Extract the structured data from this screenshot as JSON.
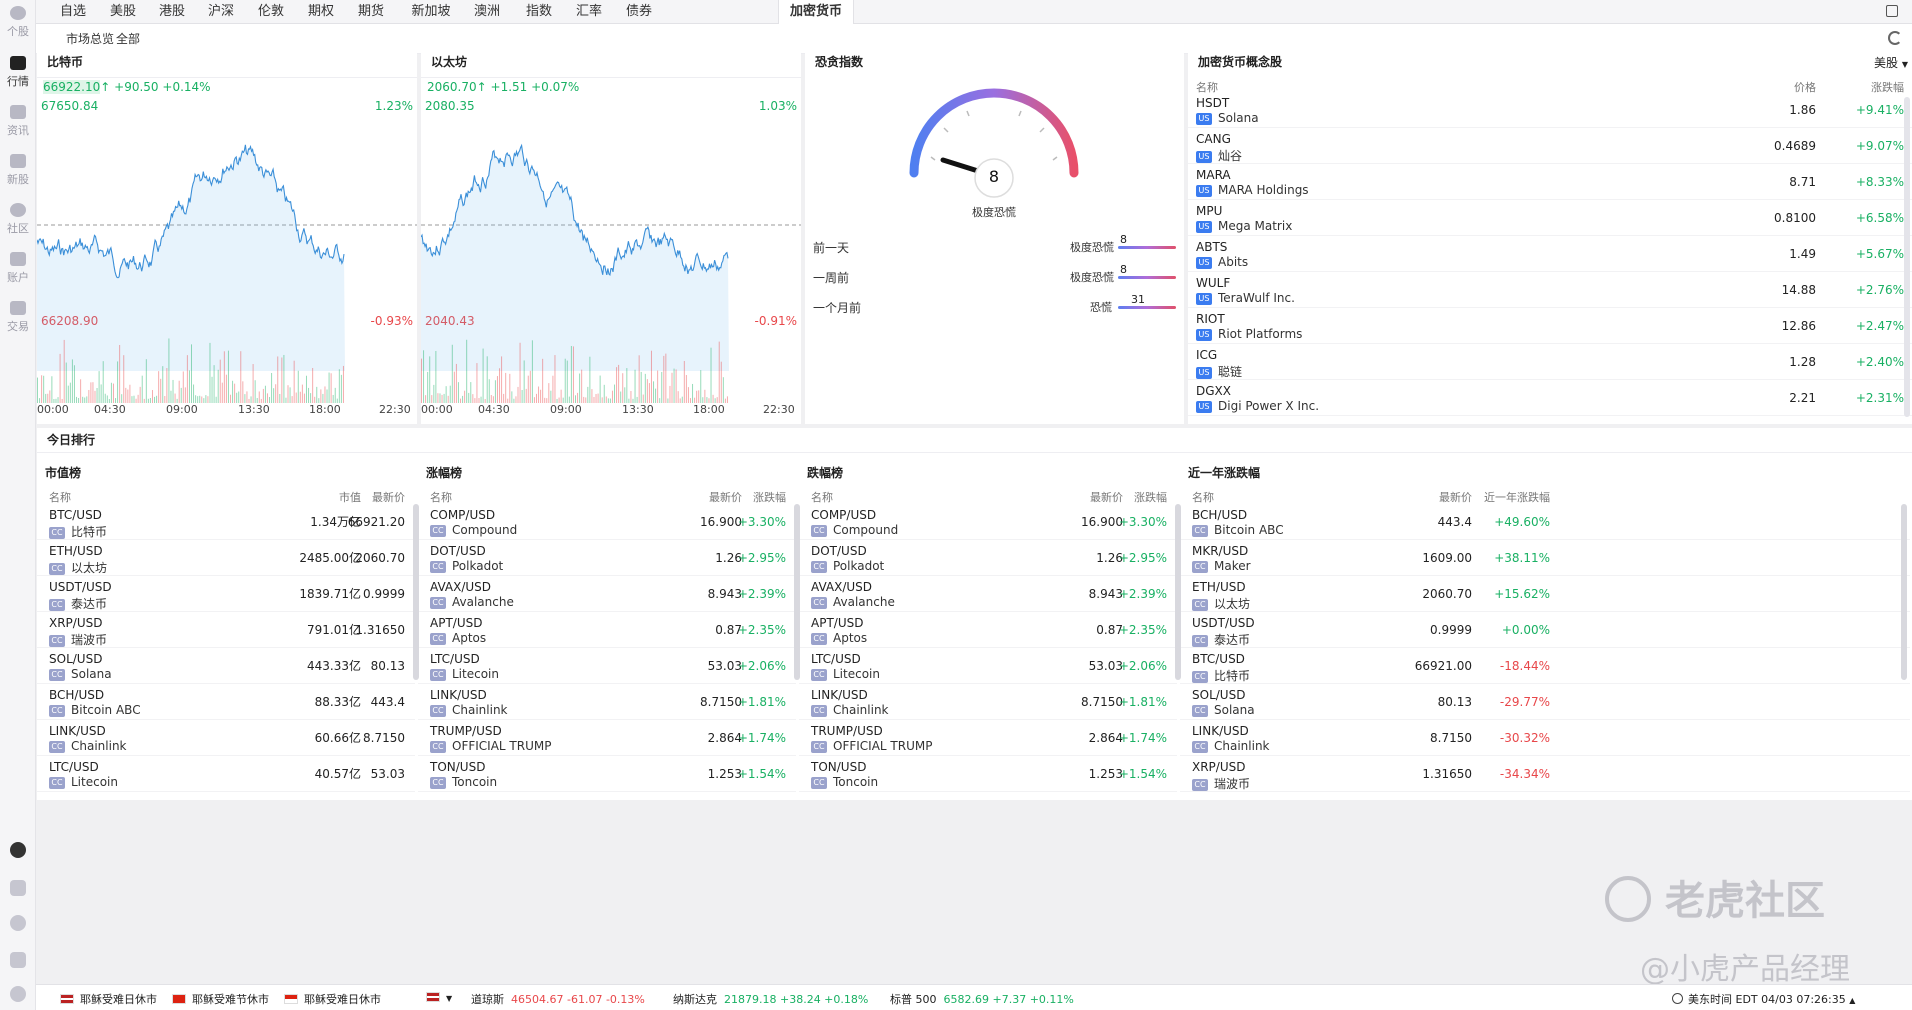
{
  "sidebar": {
    "items": [
      {
        "label": "个股"
      },
      {
        "label": "行情"
      },
      {
        "label": "资讯"
      },
      {
        "label": "新股"
      },
      {
        "label": "社区"
      },
      {
        "label": "账户"
      },
      {
        "label": "交易"
      }
    ]
  },
  "tabs": [
    "自选",
    "美股",
    "港股",
    "沪深",
    "伦敦",
    "期权",
    "期货",
    "新加坡",
    "澳洲",
    "指数",
    "汇率",
    "债券",
    "加密货币"
  ],
  "subtabs": [
    "市场总览",
    "全部"
  ],
  "btc": {
    "title": "比特币",
    "price": "66922.10",
    "arrow": "↑",
    "change": "+90.50",
    "pct": "+0.14%",
    "high": "67650.84",
    "high_pct": "1.23%",
    "low": "66208.90",
    "low_pct": "-0.93%",
    "times": [
      "00:00",
      "04:30",
      "09:00",
      "13:30",
      "18:00",
      "22:30"
    ]
  },
  "eth": {
    "title": "以太坊",
    "price": "2060.70",
    "arrow": "↑",
    "change": "+1.51",
    "pct": "+0.07%",
    "high": "2080.35",
    "high_pct": "1.03%",
    "low": "2040.43",
    "low_pct": "-0.91%",
    "times": [
      "00:00",
      "04:30",
      "09:00",
      "13:30",
      "18:00",
      "22:30"
    ]
  },
  "fear": {
    "title": "恐贪指数",
    "value": "8",
    "label": "极度恐慌",
    "history": [
      {
        "period": "前一天",
        "status": "极度恐慌",
        "value": "8",
        "level": 8
      },
      {
        "period": "一周前",
        "status": "极度恐慌",
        "value": "8",
        "level": 8
      },
      {
        "period": "一个月前",
        "status": "恐慌",
        "value": "31",
        "level": 31
      }
    ]
  },
  "concept": {
    "title": "加密货币概念股",
    "market": "美股",
    "headers": [
      "名称",
      "价格",
      "涨跌幅"
    ],
    "rows": [
      {
        "sym": "HSDT",
        "badge": "US",
        "name": "Solana",
        "price": "1.86",
        "chg": "+9.41%"
      },
      {
        "sym": "CANG",
        "badge": "US",
        "name": "灿谷",
        "price": "0.4689",
        "chg": "+9.07%"
      },
      {
        "sym": "MARA",
        "badge": "US",
        "name": "MARA Holdings",
        "price": "8.71",
        "chg": "+8.33%"
      },
      {
        "sym": "MPU",
        "badge": "US",
        "name": "Mega Matrix",
        "price": "0.8100",
        "chg": "+6.58%"
      },
      {
        "sym": "ABTS",
        "badge": "US",
        "name": "Abits",
        "price": "1.49",
        "chg": "+5.67%"
      },
      {
        "sym": "WULF",
        "badge": "US",
        "name": "TeraWulf Inc.",
        "price": "14.88",
        "chg": "+2.76%"
      },
      {
        "sym": "RIOT",
        "badge": "US",
        "name": "Riot Platforms",
        "price": "12.86",
        "chg": "+2.47%"
      },
      {
        "sym": "ICG",
        "badge": "US",
        "name": "聪链",
        "price": "1.28",
        "chg": "+2.40%"
      },
      {
        "sym": "DGXX",
        "badge": "US",
        "name": "Digi Power X Inc.",
        "price": "2.21",
        "chg": "+2.31%"
      }
    ]
  },
  "ranking": {
    "title": "今日排行",
    "market_cap": {
      "title": "市值榜",
      "headers": [
        "名称",
        "市值",
        "最新价"
      ],
      "rows": [
        {
          "sym": "BTC/USD",
          "name": "比特币",
          "a": "1.34万亿",
          "b": "66921.20"
        },
        {
          "sym": "ETH/USD",
          "name": "以太坊",
          "a": "2485.00亿",
          "b": "2060.70"
        },
        {
          "sym": "USDT/USD",
          "name": "泰达币",
          "a": "1839.71亿",
          "b": "0.9999"
        },
        {
          "sym": "XRP/USD",
          "name": "瑞波币",
          "a": "791.01亿",
          "b": "1.31650"
        },
        {
          "sym": "SOL/USD",
          "name": "Solana",
          "a": "443.33亿",
          "b": "80.13"
        },
        {
          "sym": "BCH/USD",
          "name": "Bitcoin ABC",
          "a": "88.33亿",
          "b": "443.4"
        },
        {
          "sym": "LINK/USD",
          "name": "Chainlink",
          "a": "60.66亿",
          "b": "8.7150"
        },
        {
          "sym": "LTC/USD",
          "name": "Litecoin",
          "a": "40.57亿",
          "b": "53.03"
        }
      ]
    },
    "gainers": {
      "title": "涨幅榜",
      "headers": [
        "名称",
        "最新价",
        "涨跌幅"
      ],
      "rows": [
        {
          "sym": "COMP/USD",
          "name": "Compound",
          "a": "16.900",
          "b": "+3.30%"
        },
        {
          "sym": "DOT/USD",
          "name": "Polkadot",
          "a": "1.26",
          "b": "+2.95%"
        },
        {
          "sym": "AVAX/USD",
          "name": "Avalanche",
          "a": "8.943",
          "b": "+2.39%"
        },
        {
          "sym": "APT/USD",
          "name": "Aptos",
          "a": "0.87",
          "b": "+2.35%"
        },
        {
          "sym": "LTC/USD",
          "name": "Litecoin",
          "a": "53.03",
          "b": "+2.06%"
        },
        {
          "sym": "LINK/USD",
          "name": "Chainlink",
          "a": "8.7150",
          "b": "+1.81%"
        },
        {
          "sym": "TRUMP/USD",
          "name": "OFFICIAL TRUMP",
          "a": "2.864",
          "b": "+1.74%"
        },
        {
          "sym": "TON/USD",
          "name": "Toncoin",
          "a": "1.253",
          "b": "+1.54%"
        }
      ]
    },
    "losers": {
      "title": "跌幅榜",
      "headers": [
        "名称",
        "最新价",
        "涨跌幅"
      ],
      "rows": [
        {
          "sym": "COMP/USD",
          "name": "Compound",
          "a": "16.900",
          "b": "+3.30%"
        },
        {
          "sym": "DOT/USD",
          "name": "Polkadot",
          "a": "1.26",
          "b": "+2.95%"
        },
        {
          "sym": "AVAX/USD",
          "name": "Avalanche",
          "a": "8.943",
          "b": "+2.39%"
        },
        {
          "sym": "APT/USD",
          "name": "Aptos",
          "a": "0.87",
          "b": "+2.35%"
        },
        {
          "sym": "LTC/USD",
          "name": "Litecoin",
          "a": "53.03",
          "b": "+2.06%"
        },
        {
          "sym": "LINK/USD",
          "name": "Chainlink",
          "a": "8.7150",
          "b": "+1.81%"
        },
        {
          "sym": "TRUMP/USD",
          "name": "OFFICIAL TRUMP",
          "a": "2.864",
          "b": "+1.74%"
        },
        {
          "sym": "TON/USD",
          "name": "Toncoin",
          "a": "1.253",
          "b": "+1.54%"
        }
      ]
    },
    "yearly": {
      "title": "近一年涨跌幅",
      "headers": [
        "名称",
        "最新价",
        "近一年涨跌幅"
      ],
      "rows": [
        {
          "sym": "BCH/USD",
          "name": "Bitcoin ABC",
          "a": "443.4",
          "b": "+49.60%"
        },
        {
          "sym": "MKR/USD",
          "name": "Maker",
          "a": "1609.00",
          "b": "+38.11%"
        },
        {
          "sym": "ETH/USD",
          "name": "以太坊",
          "a": "2060.70",
          "b": "+15.62%"
        },
        {
          "sym": "USDT/USD",
          "name": "泰达币",
          "a": "0.9999",
          "b": "+0.00%"
        },
        {
          "sym": "BTC/USD",
          "name": "比特币",
          "a": "66921.00",
          "b": "-18.44%"
        },
        {
          "sym": "SOL/USD",
          "name": "Solana",
          "a": "80.13",
          "b": "-29.77%"
        },
        {
          "sym": "LINK/USD",
          "name": "Chainlink",
          "a": "8.7150",
          "b": "-30.32%"
        },
        {
          "sym": "XRP/USD",
          "name": "瑞波币",
          "a": "1.31650",
          "b": "-34.34%"
        }
      ]
    }
  },
  "status": {
    "holidays": [
      "耶稣受难日休市",
      "耶稣受难节休市",
      "耶稣受难日休市"
    ],
    "indices": [
      {
        "name": "道琼斯",
        "value": "46504.67 -61.07 -0.13%"
      },
      {
        "name": "纳斯达克",
        "value": "21879.18 +38.24 +0.18%"
      },
      {
        "name": "标普 500",
        "value": "6582.69 +7.37 +0.11%"
      }
    ],
    "time": "美东时间  EDT 04/03 07:26:35"
  },
  "watermark": {
    "brand": "老虎社区",
    "author": "@小虎产品经理"
  }
}
